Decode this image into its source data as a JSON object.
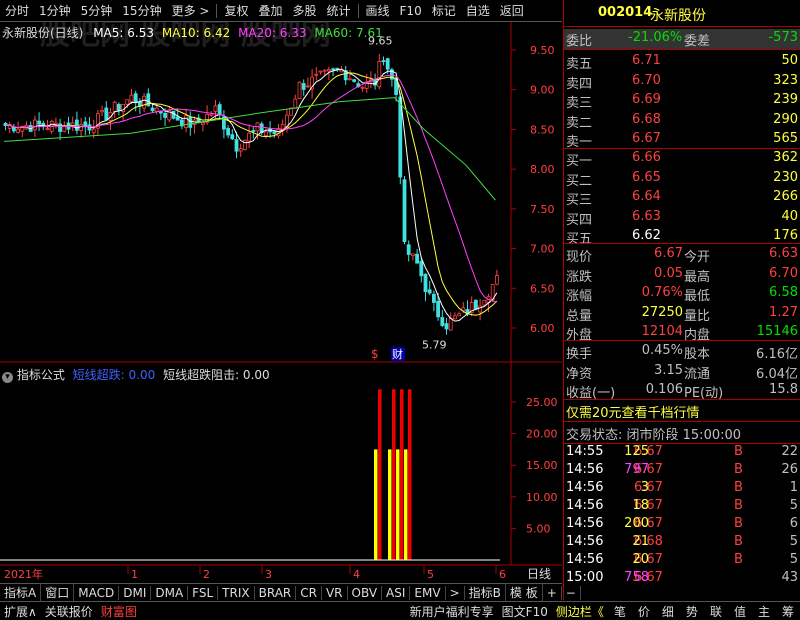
{
  "toolbar": {
    "items": [
      "分时",
      "1分钟",
      "5分钟",
      "15分钟",
      "更多 >",
      "复权",
      "叠加",
      "多股",
      "统计",
      "画线",
      "F10",
      "标记",
      "自选",
      "返回"
    ]
  },
  "chart_header": {
    "stock_label": "永新股份(日线)",
    "ma5": "MA5: 6.53",
    "ma10": "MA10: 6.42",
    "ma20": "MA20: 6.33",
    "ma60": "MA60: 7.61"
  },
  "watermark": "股吧网 股吧网 股吧网",
  "price_axis": [
    "9.50",
    "9.00",
    "8.50",
    "8.00",
    "7.50",
    "7.00",
    "6.50",
    "6.00"
  ],
  "annotations": {
    "high": "9.65",
    "low": "5.79",
    "marker_s": "$",
    "marker_cai": "财"
  },
  "indicator_header": {
    "title": "指标公式",
    "label1": "短线超跌: 0.00",
    "label2": "短线超跌阻击: 0.00"
  },
  "indicator_axis": [
    "25.00",
    "20.00",
    "15.00",
    "10.00",
    "5.00"
  ],
  "date_axis": {
    "year": "2021年",
    "months": [
      "1",
      "2",
      "3",
      "4",
      "5",
      "6"
    ]
  },
  "period_label": "日线",
  "bottom_tabs": [
    "指标A",
    "窗口",
    "MACD",
    "DMI",
    "DMA",
    "FSL",
    "TRIX",
    "BRAR",
    "CR",
    "VR",
    "OBV",
    "ASI",
    "EMV",
    ">",
    "指标B",
    "模 板",
    "+",
    "−"
  ],
  "footer": {
    "left": [
      "扩展∧",
      "关联报价",
      "财富图"
    ],
    "middle": [
      "新用户福利专享",
      "图文F10",
      "侧边栏《"
    ],
    "right": [
      "笔",
      "价",
      "细",
      "势",
      "联",
      "值",
      "主",
      "筹"
    ]
  },
  "quote": {
    "code": "002014",
    "name": "永新股份",
    "weibi_label": "委比",
    "weibi": "-21.06%",
    "weicha_label": "委差",
    "weicha": "-573",
    "asks": [
      {
        "label": "卖五",
        "price": "6.71",
        "vol": "50"
      },
      {
        "label": "卖四",
        "price": "6.70",
        "vol": "323"
      },
      {
        "label": "卖三",
        "price": "6.69",
        "vol": "239"
      },
      {
        "label": "卖二",
        "price": "6.68",
        "vol": "290"
      },
      {
        "label": "卖一",
        "price": "6.67",
        "vol": "565"
      }
    ],
    "bids": [
      {
        "label": "买一",
        "price": "6.66",
        "vol": "362"
      },
      {
        "label": "买二",
        "price": "6.65",
        "vol": "230"
      },
      {
        "label": "买三",
        "price": "6.64",
        "vol": "266"
      },
      {
        "label": "买四",
        "price": "6.63",
        "vol": "40"
      },
      {
        "label": "买五",
        "price": "6.62",
        "vol": "176"
      }
    ],
    "stats": [
      {
        "l1": "现价",
        "v1": "6.67",
        "l2": "今开",
        "v2": "6.63"
      },
      {
        "l1": "涨跌",
        "v1": "0.05",
        "l2": "最高",
        "v2": "6.70"
      },
      {
        "l1": "涨幅",
        "v1": "0.76%",
        "l2": "最低",
        "v2": "6.58"
      },
      {
        "l1": "总量",
        "v1": "27250",
        "l2": "量比",
        "v2": "1.27"
      },
      {
        "l1": "外盘",
        "v1": "12104",
        "l2": "内盘",
        "v2": "15146"
      }
    ],
    "stats2": [
      {
        "l1": "换手",
        "v1": "0.45%",
        "l2": "股本",
        "v2": "6.16亿"
      },
      {
        "l1": "净资",
        "v1": "3.15",
        "l2": "流通",
        "v2": "6.04亿"
      },
      {
        "l1": "收益(一)",
        "v1": "0.106",
        "l2": "PE(动)",
        "v2": "15.8"
      }
    ],
    "promo": "仅需20元查看千档行情",
    "trade_status": "交易状态: 闭市阶段 15:00:00",
    "ticks": [
      {
        "time": "14:55",
        "price": "6.67",
        "vol": "125",
        "side": "B",
        "n": "22"
      },
      {
        "time": "14:56",
        "price": "6.67",
        "vol": "797",
        "side": "B",
        "n": "26"
      },
      {
        "time": "14:56",
        "price": "6.67",
        "vol": "3",
        "side": "B",
        "n": "1"
      },
      {
        "time": "14:56",
        "price": "6.67",
        "vol": "18",
        "side": "B",
        "n": "5"
      },
      {
        "time": "14:56",
        "price": "6.67",
        "vol": "200",
        "side": "B",
        "n": "6"
      },
      {
        "time": "14:56",
        "price": "6.68",
        "vol": "21",
        "side": "B",
        "n": "5"
      },
      {
        "time": "14:56",
        "price": "6.67",
        "vol": "20",
        "side": "B",
        "n": "5"
      },
      {
        "time": "15:00",
        "price": "6.67",
        "vol": "758",
        "side": "",
        "n": "43"
      }
    ]
  }
}
